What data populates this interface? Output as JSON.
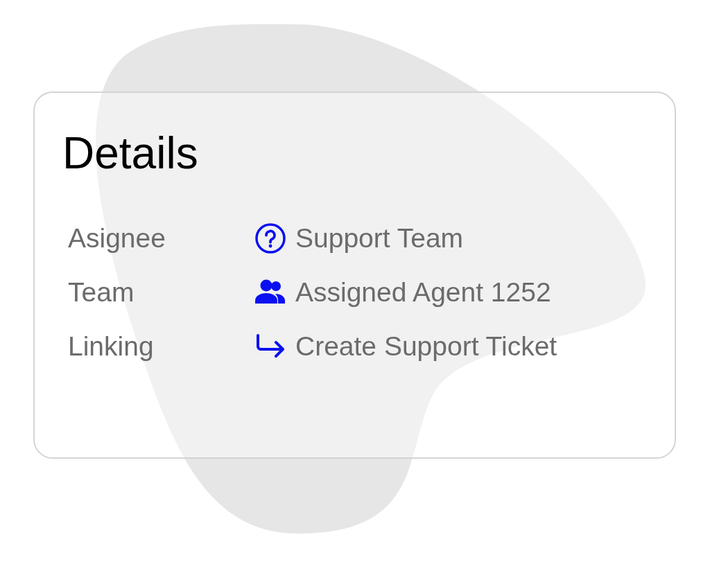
{
  "title": "Details",
  "rows": [
    {
      "label": "Asignee",
      "kind": "question",
      "value": "Support Team"
    },
    {
      "label": "Team",
      "kind": "people",
      "value": "Assigned Agent 1252"
    },
    {
      "label": "Linking",
      "kind": "link",
      "value": "Create Support Ticket"
    }
  ]
}
